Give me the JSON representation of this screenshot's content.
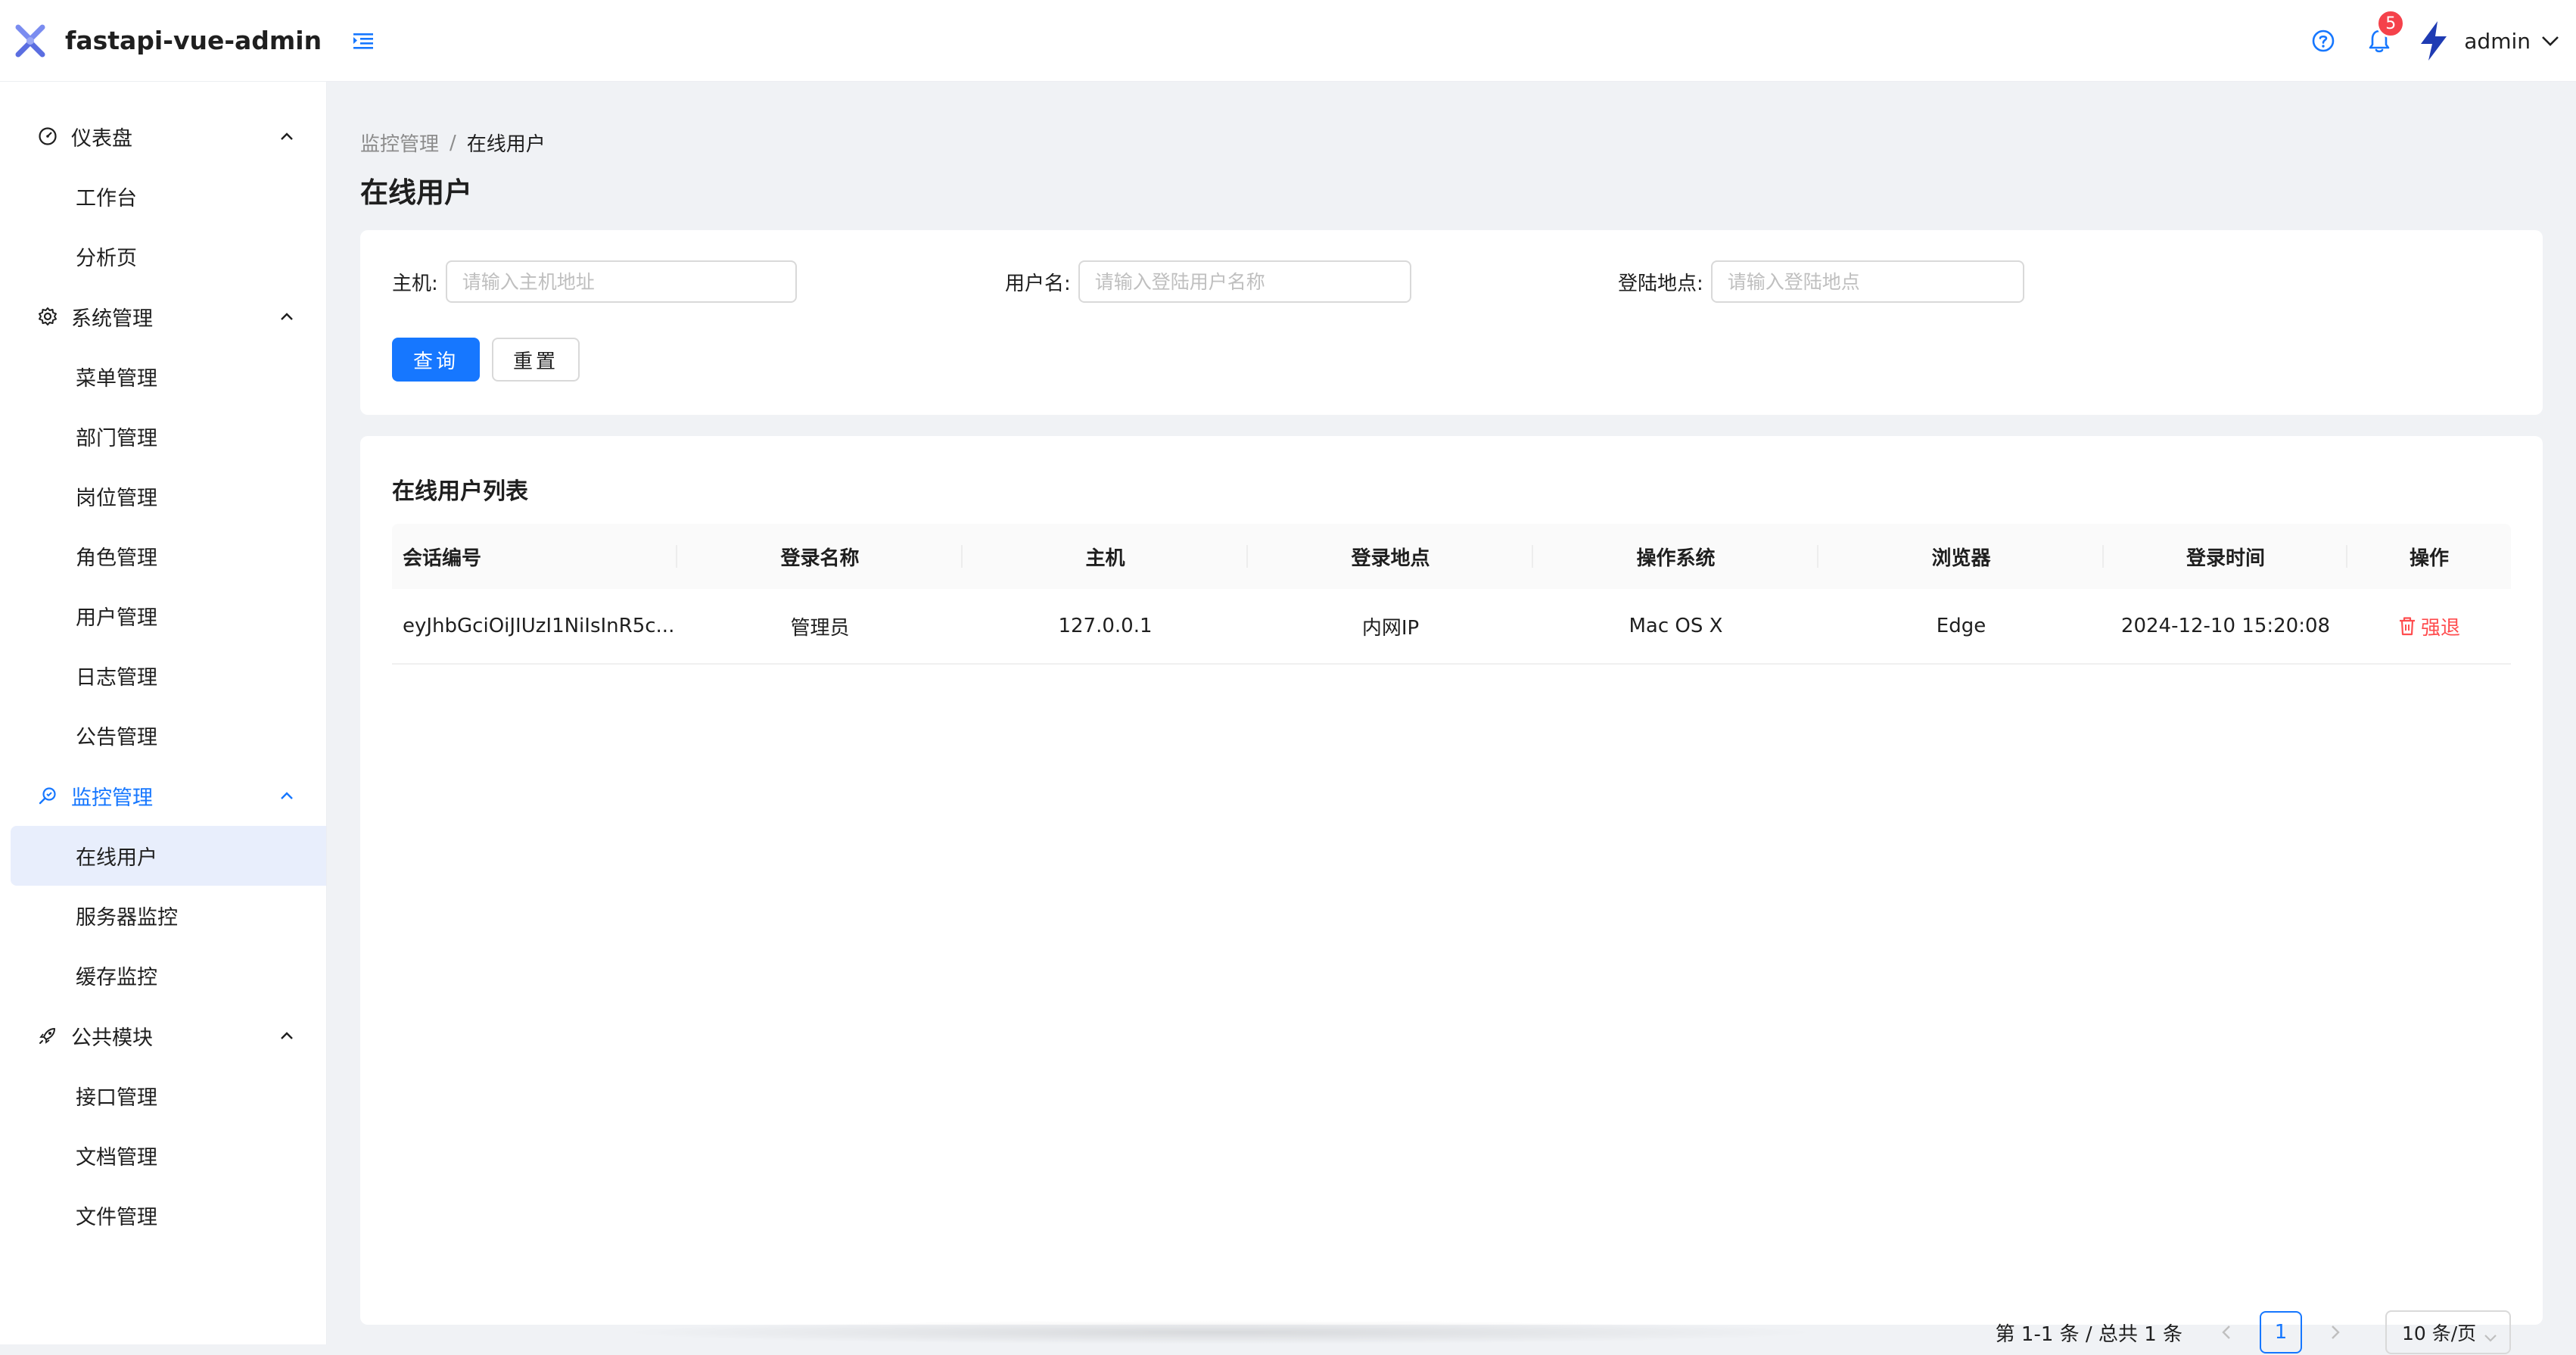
{
  "app": {
    "title": "fastapi-vue-admin"
  },
  "header": {
    "notification_count": "5",
    "username": "admin"
  },
  "sidebar": {
    "groups": [
      {
        "label": "仪表盘",
        "icon": "dashboard-icon",
        "items": [
          "工作台",
          "分析页"
        ]
      },
      {
        "label": "系统管理",
        "icon": "gear-icon",
        "items": [
          "菜单管理",
          "部门管理",
          "岗位管理",
          "角色管理",
          "用户管理",
          "日志管理",
          "公告管理"
        ]
      },
      {
        "label": "监控管理",
        "icon": "monitor-icon",
        "items": [
          "在线用户",
          "服务器监控",
          "缓存监控"
        ],
        "active": true,
        "selected_item": "在线用户"
      },
      {
        "label": "公共模块",
        "icon": "rocket-icon",
        "items": [
          "接口管理",
          "文档管理",
          "文件管理"
        ]
      }
    ]
  },
  "breadcrumb": {
    "parent": "监控管理",
    "separator": "/",
    "current": "在线用户"
  },
  "page": {
    "title": "在线用户"
  },
  "search": {
    "host": {
      "label": "主机:",
      "placeholder": "请输入主机地址",
      "value": ""
    },
    "username": {
      "label": "用户名:",
      "placeholder": "请输入登陆用户名称",
      "value": ""
    },
    "location": {
      "label": "登陆地点:",
      "placeholder": "请输入登陆地点",
      "value": ""
    },
    "query_label": "查询",
    "reset_label": "重置"
  },
  "table": {
    "title": "在线用户列表",
    "columns": [
      "会话编号",
      "登录名称",
      "主机",
      "登录地点",
      "操作系统",
      "浏览器",
      "登录时间",
      "操作"
    ],
    "rows": [
      {
        "session_id": "eyJhbGciOiJIUzI1NiIsInR5c...",
        "login_name": "管理员",
        "host": "127.0.0.1",
        "location": "内网IP",
        "os": "Mac OS X",
        "browser": "Edge",
        "login_time": "2024-12-10 15:20:08",
        "action": "强退"
      }
    ]
  },
  "pagination": {
    "total_text": "第 1-1 条 / 总共 1 条",
    "current_page": "1",
    "page_size": "10 条/页"
  },
  "colors": {
    "primary": "#1677ff",
    "danger": "#ff4d4f",
    "badge": "#f5424b",
    "selected_bg": "#e8eefc"
  }
}
